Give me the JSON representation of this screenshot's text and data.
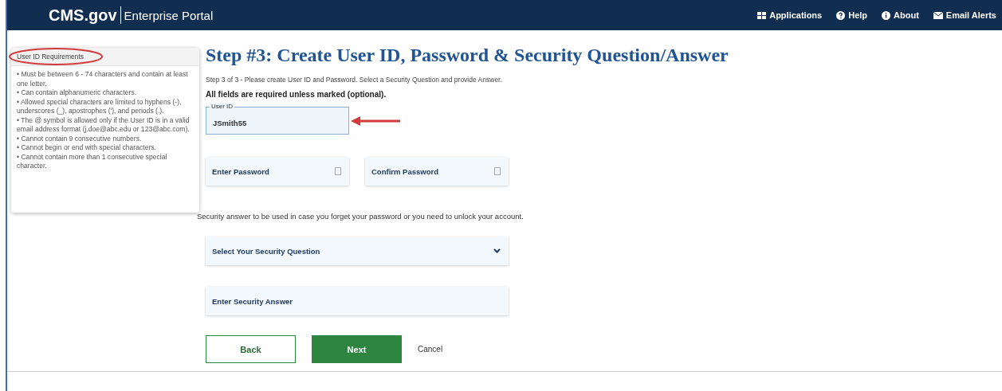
{
  "header": {
    "logo": "CMS.gov",
    "portal": "Enterprise Portal",
    "nav": [
      {
        "label": "Applications",
        "kind": "grid"
      },
      {
        "label": "Help",
        "kind": "help"
      },
      {
        "label": "About",
        "kind": "info"
      },
      {
        "label": "Email Alerts",
        "kind": "mail"
      }
    ]
  },
  "requirements": {
    "title": "User ID Requirements",
    "items": [
      "• Must be between 6 - 74 characters and contain at least one letter.",
      "• Can contain alphanumeric characters.",
      "• Allowed special characters are limited to hyphens (-), underscores (_), apostrophes ('), and periods (.).",
      "• The @ symbol is allowed only if the User ID is in a valid email address format (j.doe@abc.edu or 123@abc.com).",
      "• Cannot contain 9 consecutive numbers.",
      "• Cannot begin or end with special characters.",
      "• Cannot contain more than 1 consecutive special character."
    ]
  },
  "title": "Step #3: Create User ID, Password & Security Question/Answer",
  "instructions": "Step 3 of 3 - Please create User ID and Password. Select a Security Question and provide Answer.",
  "required_note": "All fields are required unless marked (optional).",
  "user_id": {
    "label": "User ID",
    "value": "JSmith55"
  },
  "password": {
    "placeholder": "Enter Password"
  },
  "confirm_password": {
    "placeholder": "Confirm Password"
  },
  "security_note": "Security answer to be used in case you forget your password or you need to unlock your account.",
  "security_question": {
    "placeholder": "Select Your Security Question"
  },
  "security_answer": {
    "placeholder": "Enter Security Answer"
  },
  "buttons": [
    {
      "label": "Back",
      "kind": "outline"
    },
    {
      "label": "Next",
      "kind": "primary"
    },
    {
      "label": "Cancel",
      "kind": "link"
    }
  ]
}
